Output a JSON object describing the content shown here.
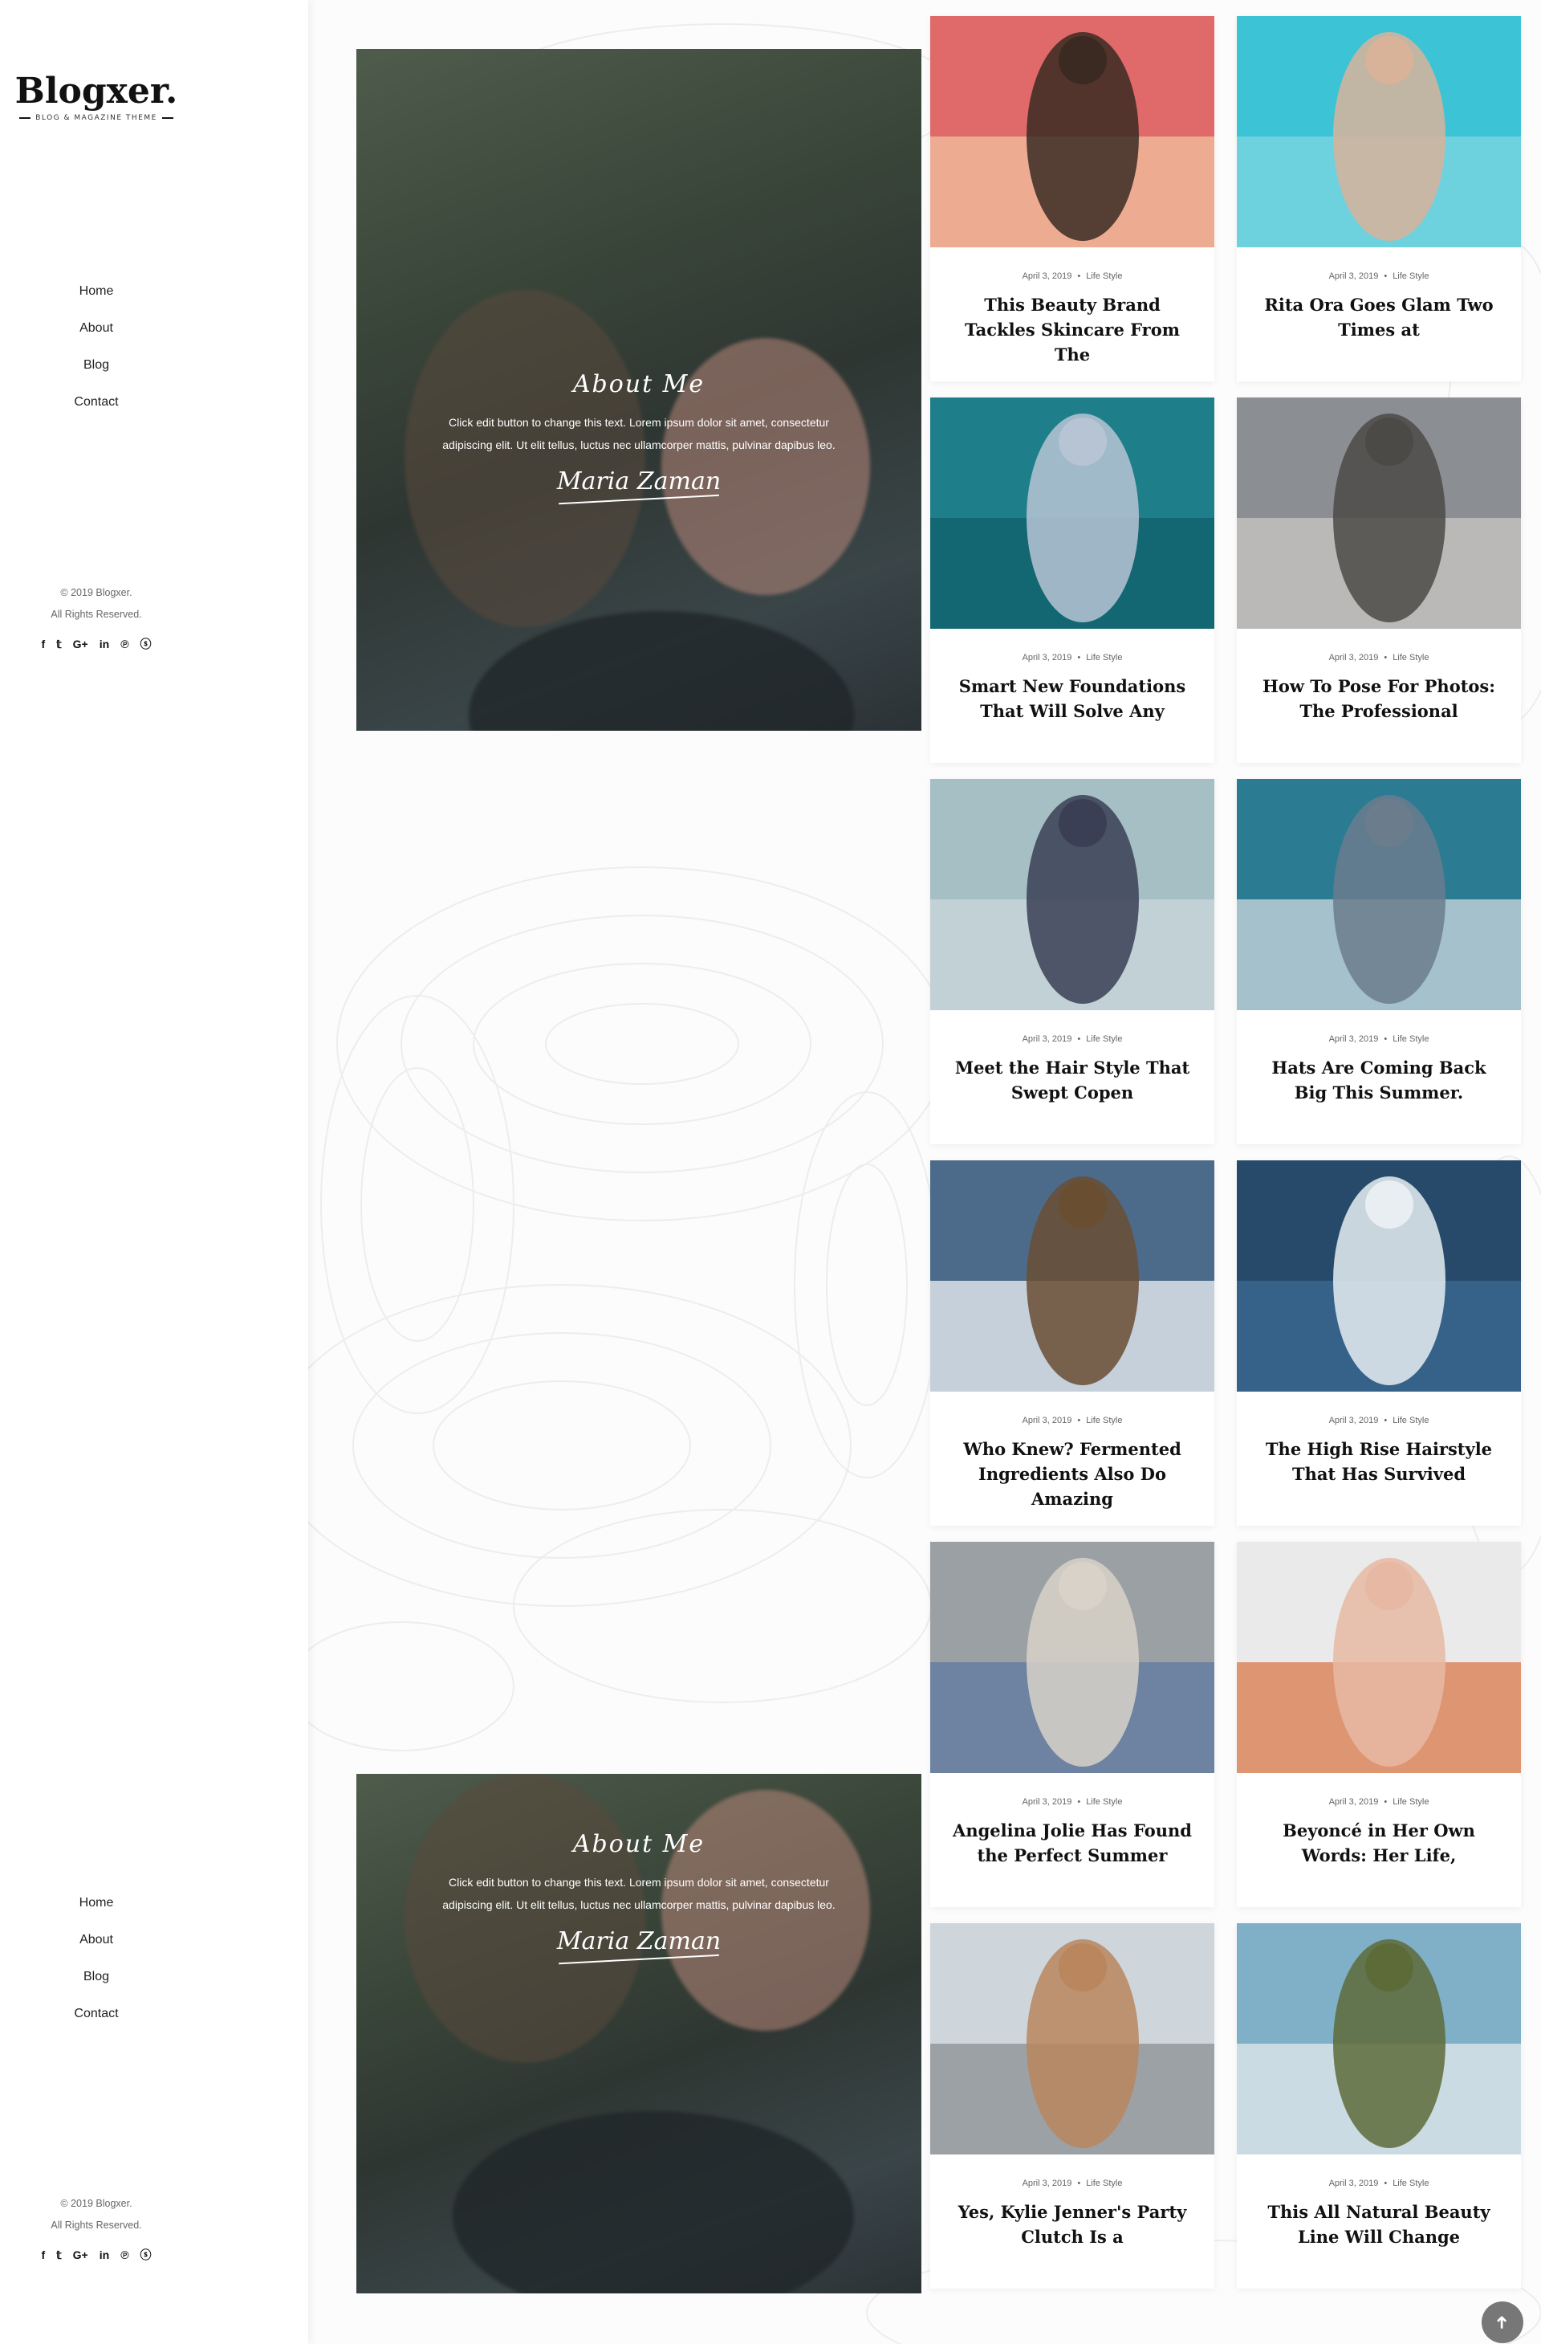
{
  "brand": {
    "name": "Blogxer.",
    "tagline": "BLOG & MAGAZINE THEME"
  },
  "nav": {
    "items": [
      "Home",
      "About",
      "Blog",
      "Contact"
    ]
  },
  "footer": {
    "copyright": "© 2019 Blogxer.",
    "rights": "All Rights Reserved.",
    "social": [
      "facebook-icon",
      "twitter-icon",
      "google-plus-icon",
      "linkedin-icon",
      "pinterest-icon",
      "skype-icon"
    ],
    "social_glyphs": [
      "f",
      "𝕥",
      "G+",
      "in",
      "℗",
      "ⓢ"
    ]
  },
  "about": {
    "title": "About Me",
    "text": "Click edit button to change this text. Lorem ipsum dolor sit amet, consectetur adipiscing elit. Ut elit tellus, luctus nec ullamcorper mattis, pulvinar dapibus leo.",
    "signature": "Maria Zaman"
  },
  "posts": [
    {
      "date": "April 3, 2019",
      "category": "Life Style",
      "title": "This Beauty Brand Tackles Skincare From The",
      "palette": [
        "#e06a6a",
        "#f2c3a0",
        "#3a2a22"
      ]
    },
    {
      "date": "April 3, 2019",
      "category": "Life Style",
      "title": "Rita Ora Goes Glam Two Times at",
      "palette": [
        "#3dc3d6",
        "#7fd6e0",
        "#d8b39a"
      ]
    },
    {
      "date": "April 3, 2019",
      "category": "Life Style",
      "title": "Smart New Foundations That Will Solve Any",
      "palette": [
        "#1e7f8a",
        "#0f5f6a",
        "#b7c4d4"
      ]
    },
    {
      "date": "April 3, 2019",
      "category": "Life Style",
      "title": "How To Pose For Photos: The Professional",
      "palette": [
        "#8b8e93",
        "#c9c7c3",
        "#4c4a47"
      ]
    },
    {
      "date": "April 3, 2019",
      "category": "Life Style",
      "title": "Meet the Hair Style That Swept Copen",
      "palette": [
        "#a6bfc5",
        "#c9d7da",
        "#3a3f55"
      ]
    },
    {
      "date": "April 3, 2019",
      "category": "Life Style",
      "title": "Hats Are Coming Back Big This Summer.",
      "palette": [
        "#2b7c93",
        "#cfd8de",
        "#6b7d8d"
      ]
    },
    {
      "date": "April 3, 2019",
      "category": "Life Style",
      "title": "Who Knew? Fermented Ingredients Also Do Amazing",
      "palette": [
        "#4c6b8a",
        "#eef1f4",
        "#6a4e32"
      ]
    },
    {
      "date": "April 3, 2019",
      "category": "Life Style",
      "title": "The High Rise Hairstyle That Has Survived",
      "palette": [
        "#274a6b",
        "#3c6a91",
        "#e8eef2"
      ]
    },
    {
      "date": "April 3, 2019",
      "category": "Life Style",
      "title": "Angelina Jolie Has Found the Perfect Summer",
      "palette": [
        "#9aa0a3",
        "#5f7aa0",
        "#d8d2c8"
      ]
    },
    {
      "date": "April 3, 2019",
      "category": "Life Style",
      "title": "Beyoncé in Her Own Words: Her Life,",
      "palette": [
        "#eaeaea",
        "#d8784a",
        "#e7b8a3"
      ]
    },
    {
      "date": "April 3, 2019",
      "category": "Life Style",
      "title": "Yes, Kylie Jenner's Party Clutch Is a",
      "palette": [
        "#cfd6db",
        "#8b8f93",
        "#b9865e"
      ]
    },
    {
      "date": "April 3, 2019",
      "category": "Life Style",
      "title": "This All Natural Beauty Line Will Change",
      "palette": [
        "#7fb0c8",
        "#e4e9ec",
        "#5d6b38"
      ]
    }
  ],
  "ui": {
    "back_to_top_icon": "arrow-up-icon",
    "back_to_top_glyph": "➜"
  }
}
